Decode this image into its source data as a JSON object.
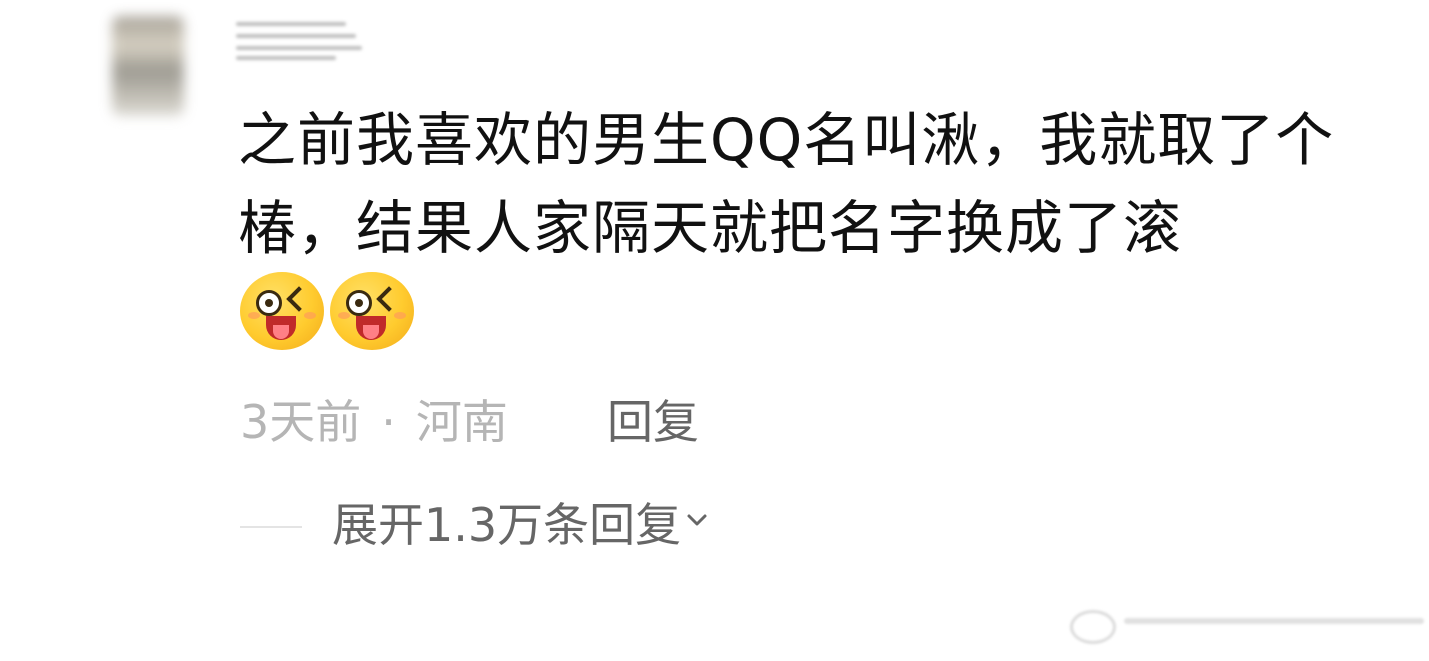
{
  "comment": {
    "text": "之前我喜欢的男生QQ名叫湫，我就取了个椿，结果人家隔天就把名字换成了滚",
    "emojis": [
      "tongue-wink-emoji",
      "tongue-wink-emoji"
    ]
  },
  "meta": {
    "time": "3天前",
    "separator": "·",
    "location": "河南",
    "reply_label": "回复"
  },
  "replies": {
    "expand_label": "展开1.3万条回复",
    "chevron_icon": "chevron-down-icon"
  },
  "colors": {
    "text": "#111111",
    "meta": "#b5b5b5",
    "action": "#666666",
    "background": "#ffffff"
  }
}
